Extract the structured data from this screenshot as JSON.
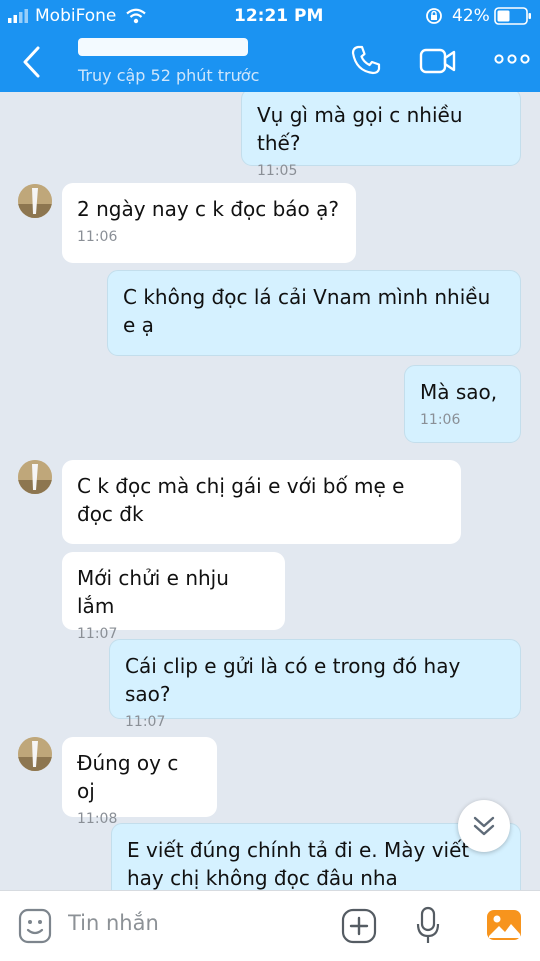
{
  "status_bar": {
    "carrier": "MobiFone",
    "time": "12:21 PM",
    "battery": "42%"
  },
  "header": {
    "last_seen": "Truy cập 52 phút trước"
  },
  "messages": [
    {
      "text": "Vụ gì mà gọi c nhiều thế?",
      "time": "11:05"
    },
    {
      "text": "2 ngày nay c k đọc báo ạ?",
      "time": "11:06"
    },
    {
      "text": "C không đọc lá cải Vnam mình nhiều e ạ",
      "time": ""
    },
    {
      "text": "Mà sao,",
      "time": "11:06"
    },
    {
      "text": "C k đọc mà chị gái e với bố mẹ e đọc đk",
      "time": ""
    },
    {
      "text": "Mới chửi e nhju lắm",
      "time": "11:07"
    },
    {
      "text": "Cái clip e gửi là có e trong đó hay sao?",
      "time": "11:07"
    },
    {
      "text": "Đúng oy c oj",
      "time": "11:08"
    },
    {
      "text": "E viết đúng chính tả đi e. Mày viết hay chị không đọc đâu nha",
      "time": ""
    }
  ],
  "composer": {
    "placeholder": "Tin nhắn"
  },
  "colors": {
    "header": "#1b93f2",
    "chat_bg": "#e2e8f0",
    "outgoing": "#d5f1ff",
    "incoming": "#ffffff",
    "attach_icon": "#f7941d"
  }
}
